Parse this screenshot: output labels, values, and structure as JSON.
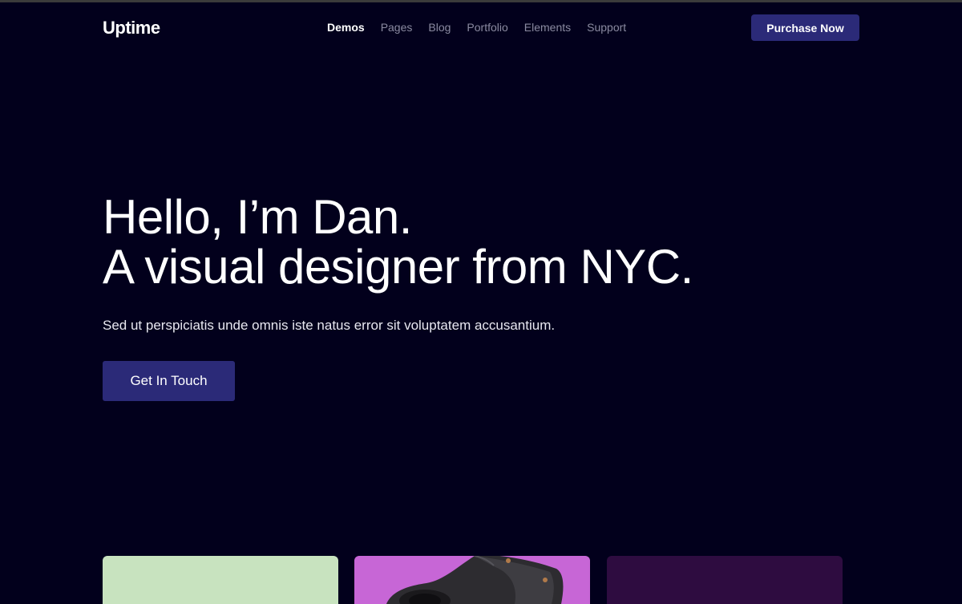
{
  "brand": {
    "logo_text": "Uptime"
  },
  "nav": {
    "items": [
      {
        "label": "Demos",
        "active": true
      },
      {
        "label": "Pages",
        "active": false
      },
      {
        "label": "Blog",
        "active": false
      },
      {
        "label": "Portfolio",
        "active": false
      },
      {
        "label": "Elements",
        "active": false
      },
      {
        "label": "Support",
        "active": false
      }
    ],
    "purchase_label": "Purchase Now"
  },
  "hero": {
    "title_line1": "Hello, I’m Dan.",
    "title_line2": "A visual designer from NYC.",
    "subtitle": "Sed ut perspiciatis unde omnis iste natus error sit voluptatem accusantium.",
    "cta_label": "Get In Touch"
  },
  "portfolio": {
    "cards": [
      {
        "color": "#c8e3bf"
      },
      {
        "color": "#c766d6",
        "icon": "vr-headset-image"
      },
      {
        "color": "#2e0c40"
      }
    ]
  },
  "theme": {
    "background": "#02001c",
    "accent": "#2b2a78",
    "nav_inactive": "#8a8aa0"
  }
}
